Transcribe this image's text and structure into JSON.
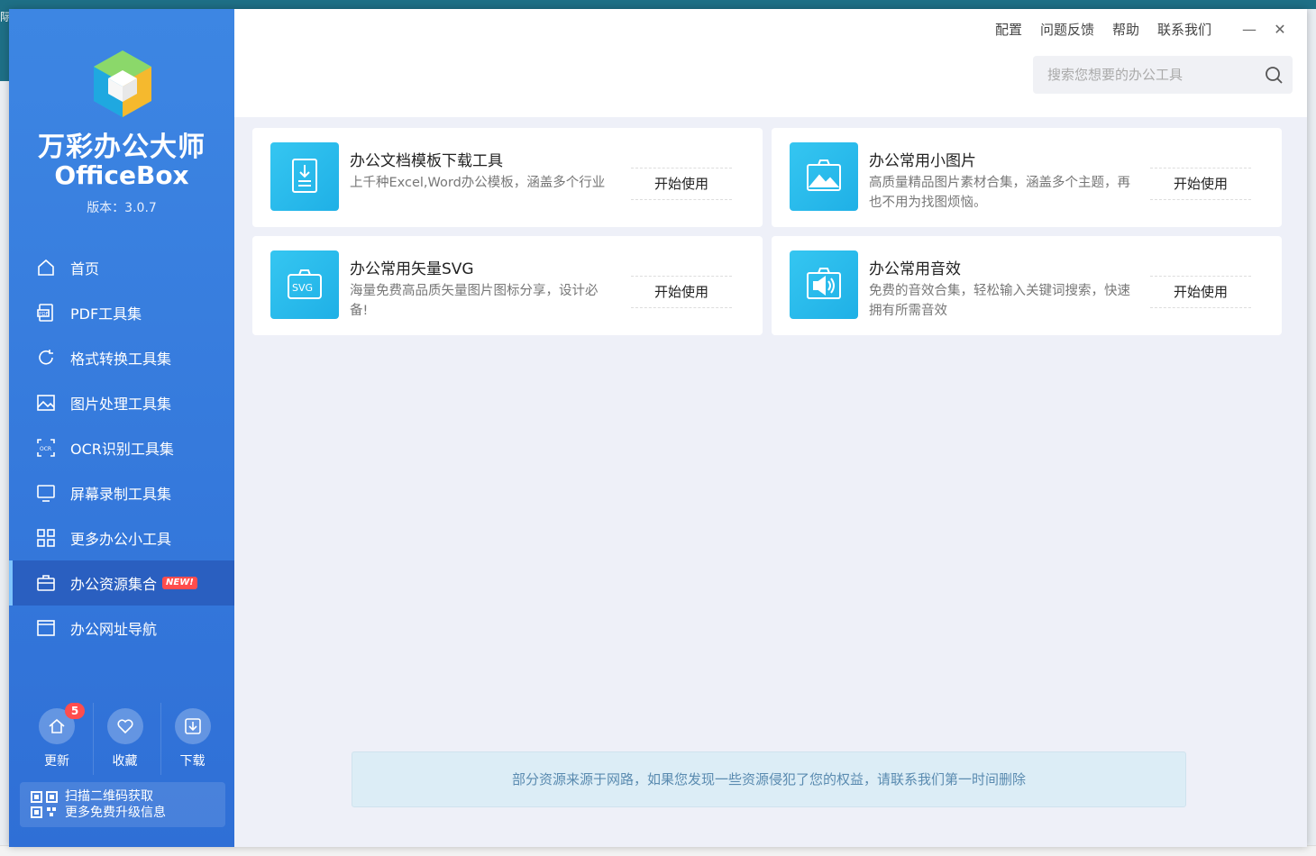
{
  "background": {
    "left_fragment": "际"
  },
  "app": {
    "brand_cn": "万彩办公大师",
    "brand_en": "OfficeBox",
    "version": "版本：3.0.7"
  },
  "sidebar": {
    "items": [
      {
        "label": "首页",
        "icon": "home-icon"
      },
      {
        "label": "PDF工具集",
        "icon": "pdf-icon"
      },
      {
        "label": "格式转换工具集",
        "icon": "refresh-icon"
      },
      {
        "label": "图片处理工具集",
        "icon": "image-icon"
      },
      {
        "label": "OCR识别工具集",
        "icon": "ocr-icon"
      },
      {
        "label": "屏幕录制工具集",
        "icon": "monitor-icon"
      },
      {
        "label": "更多办公小工具",
        "icon": "grid-icon"
      },
      {
        "label": "办公资源集合",
        "icon": "briefcase-icon",
        "badge": "NEW!",
        "active": true
      },
      {
        "label": "办公网址导航",
        "icon": "browser-icon"
      }
    ],
    "quick": [
      {
        "label": "更新",
        "icon": "update-icon",
        "count": "5"
      },
      {
        "label": "收藏",
        "icon": "heart-icon"
      },
      {
        "label": "下载",
        "icon": "download-icon"
      }
    ],
    "qr_line1": "扫描二维码获取",
    "qr_line2": "更多免费升级信息"
  },
  "header": {
    "links": [
      "配置",
      "问题反馈",
      "帮助",
      "联系我们"
    ],
    "minimize": "—",
    "close": "✕"
  },
  "search": {
    "placeholder": "搜索您想要的办公工具"
  },
  "cards": [
    {
      "title": "办公文档模板下载工具",
      "desc": "上千种Excel,Word办公模板，涵盖多个行业",
      "button": "开始使用",
      "icon": "document-download-icon"
    },
    {
      "title": "办公常用小图片",
      "desc": "高质量精品图片素材合集，涵盖多个主题，再也不用为找图烦恼。",
      "button": "开始使用",
      "icon": "picture-icon"
    },
    {
      "title": "办公常用矢量SVG",
      "desc": "海量免费高品质矢量图片图标分享，设计必备!",
      "button": "开始使用",
      "icon": "svg-icon"
    },
    {
      "title": "办公常用音效",
      "desc": "免费的音效合集，轻松输入关键词搜索，快速拥有所需音效",
      "button": "开始使用",
      "icon": "sound-icon"
    }
  ],
  "notice": "部分资源来源于网路，如果您发现一些资源侵犯了您的权益，请联系我们第一时间删除",
  "colors": {
    "sidebar": "#3578de",
    "accent": "#2cbcef",
    "active": "#2a5fc0",
    "badge": "#ff4d4d"
  }
}
